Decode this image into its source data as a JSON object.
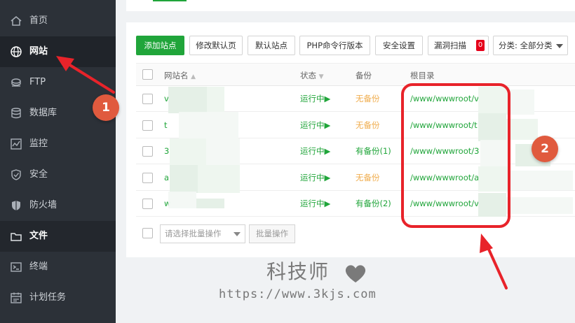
{
  "sidebar": {
    "items": [
      {
        "label": "首页",
        "icon": "home-icon"
      },
      {
        "label": "网站",
        "icon": "globe-icon"
      },
      {
        "label": "FTP",
        "icon": "ftp-icon"
      },
      {
        "label": "数据库",
        "icon": "database-icon"
      },
      {
        "label": "监控",
        "icon": "monitor-icon"
      },
      {
        "label": "安全",
        "icon": "shield-check-icon"
      },
      {
        "label": "防火墙",
        "icon": "firewall-shield-icon"
      },
      {
        "label": "文件",
        "icon": "folder-icon"
      },
      {
        "label": "终端",
        "icon": "terminal-icon"
      },
      {
        "label": "计划任务",
        "icon": "calendar-icon"
      }
    ]
  },
  "toolbar": {
    "add_site": "添加站点",
    "edit_default_page": "修改默认页",
    "default_site": "默认站点",
    "php_cli_version": "PHP命令行版本",
    "security_settings": "安全设置",
    "vuln_scan": "漏洞扫描",
    "vuln_count": "0",
    "category_select": "分类: 全部分类"
  },
  "table": {
    "headers": {
      "name": "网站名",
      "status": "状态",
      "backup": "备份",
      "root": "根目录"
    },
    "rows": [
      {
        "name": "v",
        "status": "运行中▶",
        "backup": "无备份",
        "backup_state": "none",
        "root": "/www/wwwroot/v"
      },
      {
        "name": "t",
        "status": "运行中▶",
        "backup": "无备份",
        "backup_state": "none",
        "root": "/www/wwwroot/t"
      },
      {
        "name": "3",
        "status": "运行中▶",
        "backup": "有备份(1)",
        "backup_state": "has",
        "root": "/www/wwwroot/3"
      },
      {
        "name": "a",
        "status": "运行中▶",
        "backup": "无备份",
        "backup_state": "none",
        "root": "/www/wwwroot/a"
      },
      {
        "name": "w",
        "status": "运行中▶",
        "backup": "有备份(2)",
        "backup_state": "has",
        "root": "/www/wwwroot/v"
      }
    ]
  },
  "batch": {
    "select_placeholder": "请选择批量操作",
    "button": "批量操作"
  },
  "watermark": {
    "title": "科技师",
    "url": "https://www.3kjs.com"
  },
  "annotations": {
    "marker_1": "1",
    "marker_2": "2",
    "color": "#e8232a"
  },
  "colors": {
    "accent_green": "#20a53a",
    "warning_orange": "#f0ad4e",
    "badge_red": "#e5001a",
    "sidebar_bg": "#2c3138"
  }
}
